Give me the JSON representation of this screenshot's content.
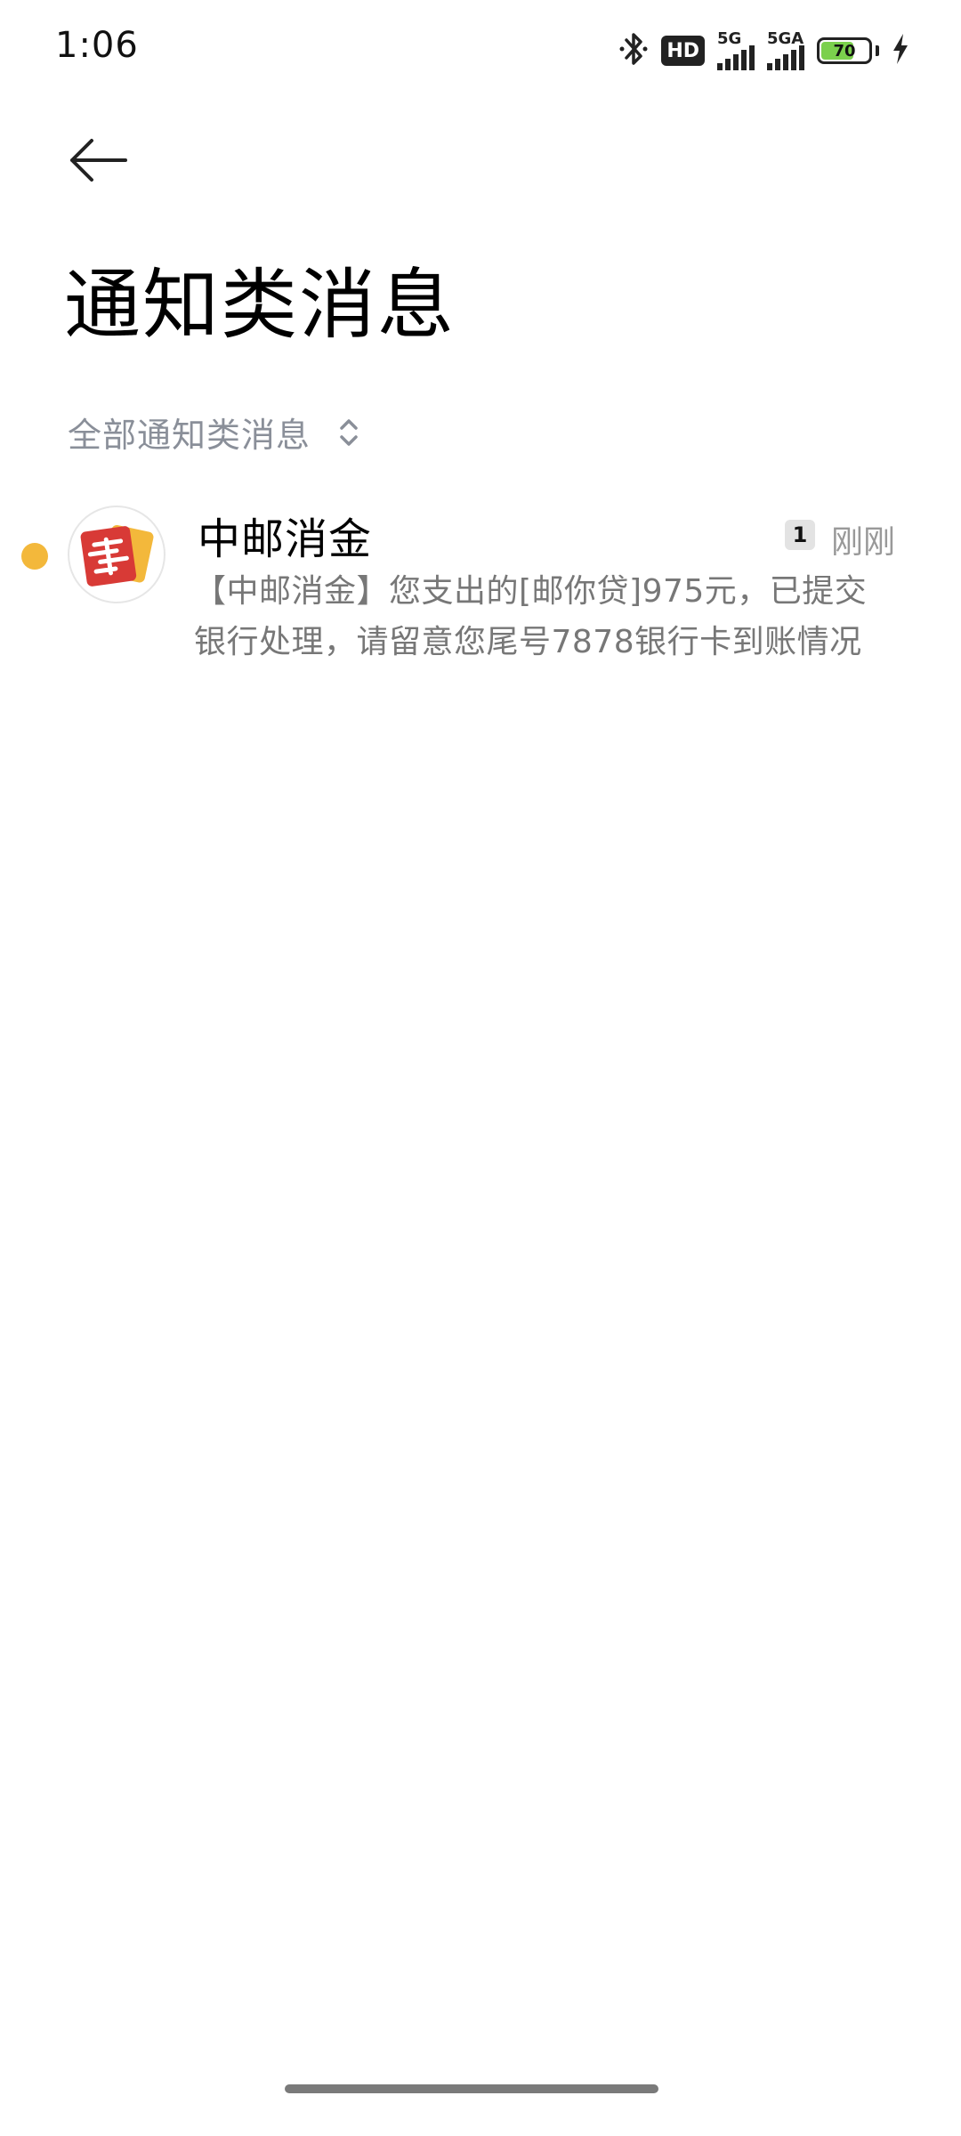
{
  "status_bar": {
    "time": "1:06",
    "hd_label": "HD",
    "network_1": "5G",
    "network_2": "5GA",
    "battery_level": "70",
    "battery_fraction": 0.7,
    "icons": [
      "bluetooth-icon",
      "signal-icon",
      "charging-icon"
    ]
  },
  "header": {
    "back_icon": "arrow-left-icon",
    "title": "通知类消息"
  },
  "filter": {
    "label": "全部通知类消息",
    "icon": "chevron-up-down-icon"
  },
  "messages": [
    {
      "sender": "中邮消金",
      "unread_count": "1",
      "time": "刚刚",
      "preview": "【中邮消金】您支出的[邮你贷]975元，已提交银行处理，请留意您尾号7878银行卡到账情况",
      "unread_color": "#f3b83b",
      "avatar_colors": [
        "#d83a36",
        "#f3b83b"
      ]
    }
  ]
}
